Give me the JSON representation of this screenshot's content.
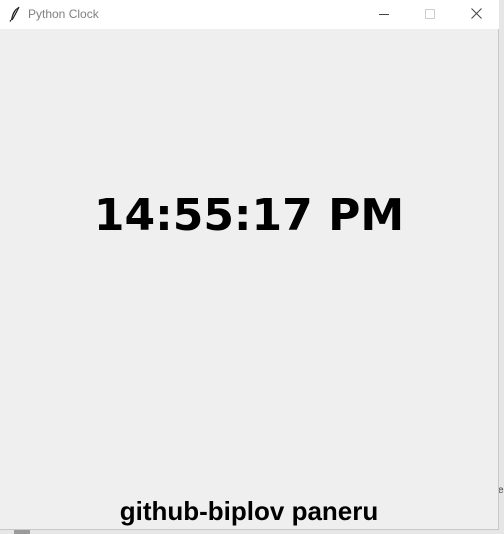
{
  "window": {
    "title": "Python Clock",
    "app_icon": "feather-icon",
    "controls": {
      "minimize_icon": "minimize-icon",
      "maximize_icon": "maximize-icon",
      "close_icon": "close-icon"
    }
  },
  "clock": {
    "time": "14:55:17 PM"
  },
  "footer": {
    "credit": "github-biplov paneru"
  },
  "desktop": {
    "edge_text": "e"
  },
  "colors": {
    "titlebar_bg": "#ffffff",
    "client_bg": "#efefef",
    "title_text": "#808080",
    "text": "#000000"
  }
}
